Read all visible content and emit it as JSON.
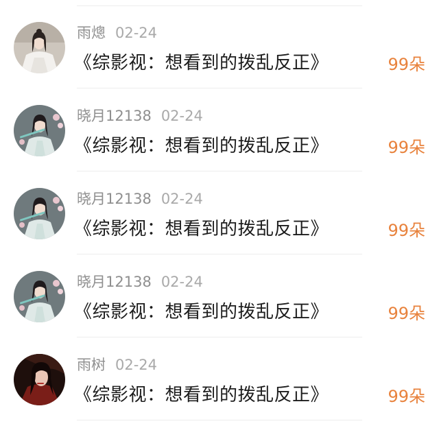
{
  "gifts": [
    {
      "user": "雨熜",
      "date": "02-24",
      "title": "《综影视：想看到的拨乱反正》",
      "count": "99朵",
      "avatar_icon": "avatar-woman-white-robe",
      "avatar_bg": "#c9c2b8"
    },
    {
      "user": "晓月12138",
      "date": "02-24",
      "title": "《综影视：想看到的拨乱反正》",
      "count": "99朵",
      "avatar_icon": "avatar-woman-flute",
      "avatar_bg": "#b9c7c4"
    },
    {
      "user": "晓月12138",
      "date": "02-24",
      "title": "《综影视：想看到的拨乱反正》",
      "count": "99朵",
      "avatar_icon": "avatar-woman-flute",
      "avatar_bg": "#b9c7c4"
    },
    {
      "user": "晓月12138",
      "date": "02-24",
      "title": "《综影视：想看到的拨乱反正》",
      "count": "99朵",
      "avatar_icon": "avatar-woman-flute",
      "avatar_bg": "#b9c7c4"
    },
    {
      "user": "雨树",
      "date": "02-24",
      "title": "《综影视：想看到的拨乱反正》",
      "count": "99朵",
      "avatar_icon": "avatar-woman-red-dark",
      "avatar_bg": "#2a1410"
    }
  ],
  "colors": {
    "count": "#e8823c",
    "name": "#8f8f8f",
    "date": "#a9a9a9",
    "title": "#1c1c1c",
    "divider": "#ededed"
  }
}
